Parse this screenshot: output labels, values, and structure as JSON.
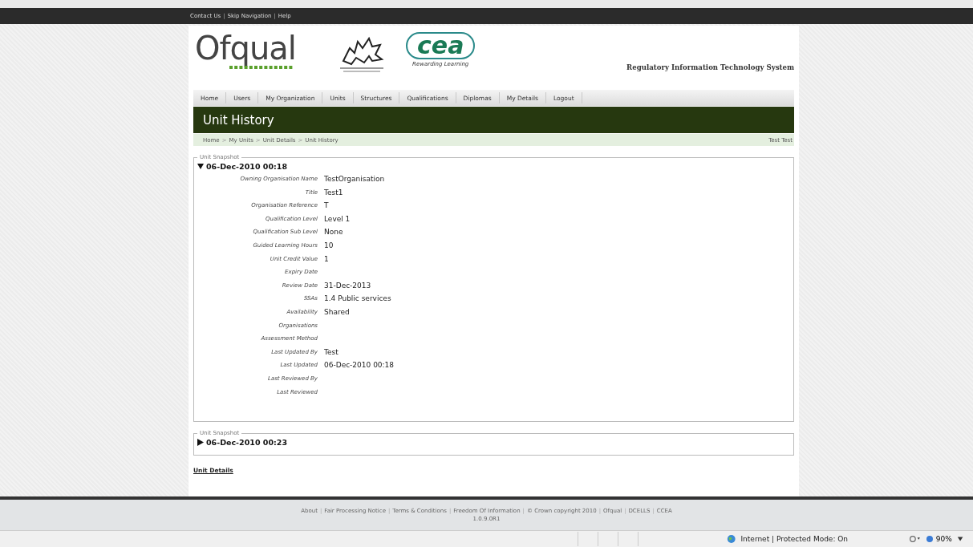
{
  "top_links": [
    {
      "kind": "link",
      "text": "Contact Us"
    },
    {
      "kind": "separator",
      "text": "|"
    },
    {
      "kind": "link",
      "text": "Skip Navigation"
    },
    {
      "kind": "separator",
      "text": "|"
    },
    {
      "kind": "link",
      "text": "Help"
    }
  ],
  "header": {
    "logo": "Ofqual",
    "cea_logo": "cea",
    "cea_tagline": "Rewarding Learning",
    "system_name": "Regulatory Information Technology System"
  },
  "nav": [
    "Home",
    "Users",
    "My Organization",
    "Units",
    "Structures",
    "Qualifications",
    "Diplomas",
    "My Details",
    "Logout"
  ],
  "page_title": "Unit History",
  "breadcrumb": [
    {
      "kind": "link",
      "text": "Home"
    },
    {
      "kind": "separator",
      "text": ">"
    },
    {
      "kind": "link",
      "text": "My Units"
    },
    {
      "kind": "separator",
      "text": ">"
    },
    {
      "kind": "link",
      "text": "Unit Details"
    },
    {
      "kind": "separator",
      "text": ">"
    },
    {
      "kind": "link",
      "text": "Unit History"
    }
  ],
  "user": "Test Test",
  "snapshots": [
    {
      "legend": "Unit Snapshot",
      "heading": "06-Dec-2010 00:18",
      "expanded": true,
      "fields": [
        {
          "label": "Owning Organisation Name",
          "value": "TestOrganisation"
        },
        {
          "label": "Title",
          "value": "Test1"
        },
        {
          "label": "Organisation Reference",
          "value": "T"
        },
        {
          "label": "Qualification Level",
          "value": "Level 1"
        },
        {
          "label": "Qualification Sub Level",
          "value": "None"
        },
        {
          "label": "Guided Learning Hours",
          "value": "10"
        },
        {
          "label": "Unit Credit Value",
          "value": "1"
        },
        {
          "label": "Expiry Date"
        },
        {
          "label": "Review Date",
          "value": "31-Dec-2013"
        },
        {
          "label": "SSAs",
          "value": "1.4 Public services"
        },
        {
          "label": "Availability",
          "value": "Shared"
        },
        {
          "label": "Organisations"
        },
        {
          "label": "Assessment Method"
        },
        {
          "label": "Last Updated By",
          "value": "Test"
        },
        {
          "label": "Last Updated",
          "value": "06-Dec-2010 00:18"
        },
        {
          "label": "Last Reviewed By"
        },
        {
          "label": "Last Reviewed"
        }
      ]
    },
    {
      "legend": "Unit Snapshot",
      "heading": "06-Dec-2010 00:23",
      "expanded": false
    }
  ],
  "bottom_link": "Unit Details",
  "footer_links": [
    {
      "kind": "link",
      "text": "About"
    },
    {
      "kind": "separator",
      "text": "|"
    },
    {
      "kind": "link",
      "text": "Fair Processing Notice"
    },
    {
      "kind": "separator",
      "text": "|"
    },
    {
      "kind": "link",
      "text": "Terms & Conditions"
    },
    {
      "kind": "separator",
      "text": "|"
    },
    {
      "kind": "link",
      "text": "Freedom Of Information"
    },
    {
      "kind": "separator",
      "text": "|"
    },
    {
      "kind": "link",
      "text": "© Crown copyright 2010"
    },
    {
      "kind": "separator",
      "text": "|"
    },
    {
      "kind": "link",
      "text": "Ofqual"
    },
    {
      "kind": "separator",
      "text": "|"
    },
    {
      "kind": "link",
      "text": "DCELLS"
    },
    {
      "kind": "separator",
      "text": "|"
    },
    {
      "kind": "link",
      "text": "CCEA"
    }
  ],
  "version": "1.0.9.0R1",
  "status_bar": {
    "zone": "Internet | Protected Mode: On",
    "zoom": "90%"
  }
}
